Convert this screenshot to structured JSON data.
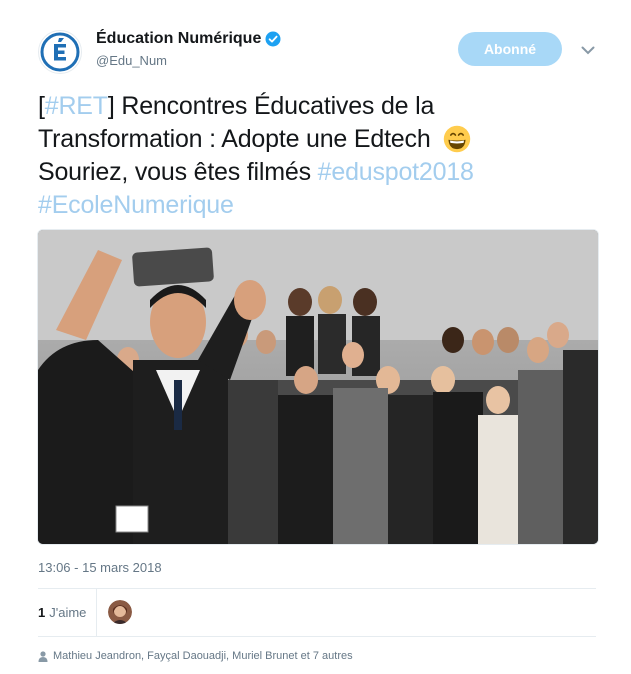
{
  "account": {
    "display_name": "Éducation Numérique",
    "handle": "@Edu_Num",
    "avatar_letter": "É",
    "verified": true
  },
  "follow_button": {
    "label": "Abonné"
  },
  "tweet": {
    "part1": "[",
    "tag_ret": "#RET",
    "part2": "] Rencontres Éducatives de la Transformation : Adopte une Edtech",
    "part3": "Souriez, vous êtes filmés",
    "tag_eduspot": "#eduspot2018",
    "tag_ecole": "#EcoleNumerique"
  },
  "timestamp": "13:06 - 15 mars 2018",
  "likes": {
    "count": "1",
    "label": "J'aime"
  },
  "context": {
    "text": "Mathieu Jeandron, Fayçal Daouadji, Muriel Brunet et 7 autres"
  },
  "colors": {
    "accent": "#1da1f2",
    "hashtag": "#a3cdee",
    "follow_bg": "#a8d8f7",
    "muted": "#657786",
    "brand_blue": "#1f6fb5"
  },
  "icons": {
    "verified": "verified-badge-icon",
    "caret": "chevron-down-icon",
    "emoji": "grinning-face-icon",
    "context": "person-icon"
  }
}
